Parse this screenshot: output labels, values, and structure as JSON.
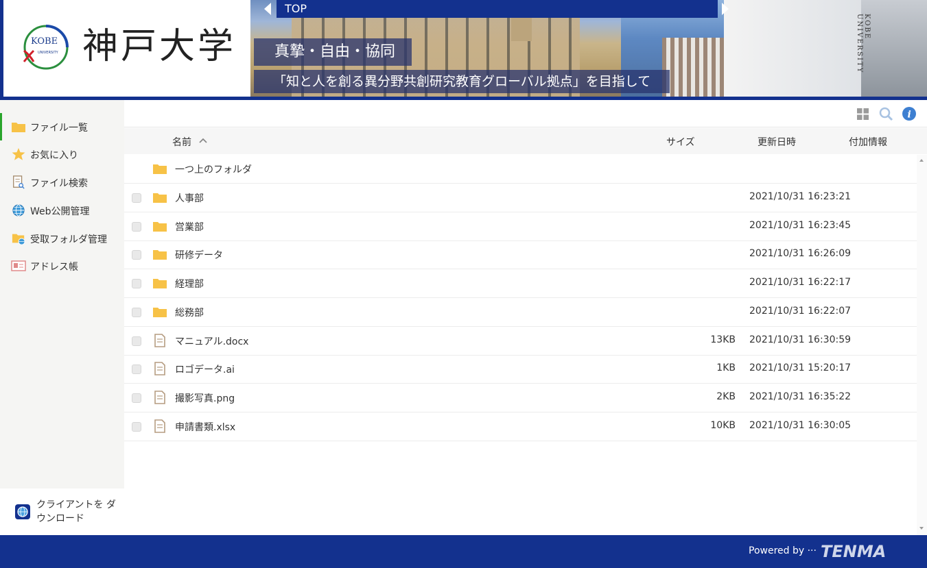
{
  "header": {
    "logo_text": "神戸大学",
    "emblem_top": "KOBE",
    "emblem_bottom": "UNIVERSITY",
    "top_label": "TOP",
    "slogan_primary": "真摯・自由・協同",
    "slogan_secondary": "「知と人を創る異分野共創研究教育グローバル拠点」を目指して",
    "vertical_text": "KOBE UNIVERSITY"
  },
  "sidebar": {
    "items": [
      {
        "label": "ファイル一覧",
        "icon": "folder-icon",
        "active": true
      },
      {
        "label": "お気に入り",
        "icon": "star-icon",
        "active": false
      },
      {
        "label": "ファイル検索",
        "icon": "file-search-icon",
        "active": false
      },
      {
        "label": "Web公開管理",
        "icon": "globe-icon",
        "active": false
      },
      {
        "label": "受取フォルダ管理",
        "icon": "folder-globe-icon",
        "active": false
      },
      {
        "label": "アドレス帳",
        "icon": "address-card-icon",
        "active": false
      }
    ],
    "client_download": "クライアントを ダウンロード"
  },
  "table": {
    "headers": {
      "name": "名前",
      "size": "サイズ",
      "modified": "更新日時",
      "extra": "付加情報"
    },
    "parent_folder": "一つ上のフォルダ",
    "rows": [
      {
        "name": "人事部",
        "type": "folder",
        "size": "",
        "modified": "2021/10/31 16:23:21"
      },
      {
        "name": "営業部",
        "type": "folder",
        "size": "",
        "modified": "2021/10/31 16:23:45"
      },
      {
        "name": "研修データ",
        "type": "folder",
        "size": "",
        "modified": "2021/10/31 16:26:09"
      },
      {
        "name": "経理部",
        "type": "folder",
        "size": "",
        "modified": "2021/10/31 16:22:17"
      },
      {
        "name": "総務部",
        "type": "folder",
        "size": "",
        "modified": "2021/10/31 16:22:07"
      },
      {
        "name": "マニュアル.docx",
        "type": "file",
        "size": "13KB",
        "modified": "2021/10/31 16:30:59"
      },
      {
        "name": "ロゴデータ.ai",
        "type": "file",
        "size": "1KB",
        "modified": "2021/10/31 15:20:17"
      },
      {
        "name": "撮影写真.png",
        "type": "file",
        "size": "2KB",
        "modified": "2021/10/31 16:35:22"
      },
      {
        "name": "申請書類.xlsx",
        "type": "file",
        "size": "10KB",
        "modified": "2021/10/31 16:30:05"
      }
    ]
  },
  "footer": {
    "powered_by": "Powered by ···",
    "brand": "TENMA"
  },
  "colors": {
    "brand_blue": "#13318e",
    "folder_yellow": "#f7c247",
    "active_green": "#2aa52c",
    "info_blue": "#3d7fd1"
  }
}
